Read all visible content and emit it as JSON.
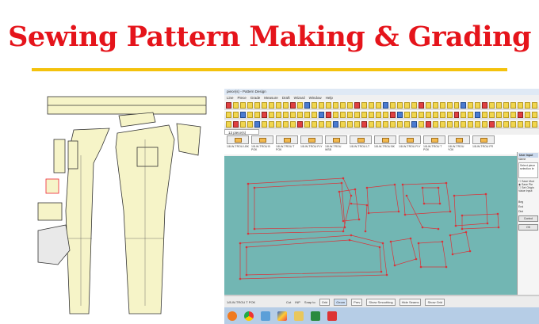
{
  "headline": "Sewing Pattern Making & Grading",
  "app": {
    "window_title": "piece(s) - Pattern Design",
    "menu": [
      "Line",
      "Piece",
      "Grade",
      "Measure",
      "Draft",
      "Wizard",
      "Window",
      "Help"
    ],
    "tab_label": "13 piece(s)",
    "thumbnails": [
      "1/8-W-TROU LBK",
      "1/8-W-TROU B POK",
      "1/8-W-TROU T POK",
      "1/8-W-TROU FLY",
      "1/8-W-TROU WSB",
      "1/8-W-TROU LT",
      "1/8-W-TROU BK",
      "1/8-W-TROU FLY",
      "1/8-W-TROU T POK",
      "1/8-W-TROU YOK",
      "1/8-W-TROU FR"
    ],
    "user_input": {
      "title": "User Input",
      "name_label": "Name",
      "message": "Select piece selection le",
      "options": [
        "Save Mod",
        "Save Pie",
        "Set Origin"
      ],
      "value_input": "Value Input",
      "fields": [
        "Beg",
        "End",
        "Dist"
      ],
      "control": "Control",
      "ok": "OK"
    },
    "status": {
      "piece": "1/8-W-TROU T POK",
      "cut": "Cut",
      "inp": "INP",
      "snap_to": "Snap to",
      "grid": "Grid",
      "geom": "Geom",
      "prev": "Prev",
      "show_smoothing": "Show Smoothing",
      "hide_seams": "Hide Seams",
      "show_grid": "Show Grid"
    }
  }
}
